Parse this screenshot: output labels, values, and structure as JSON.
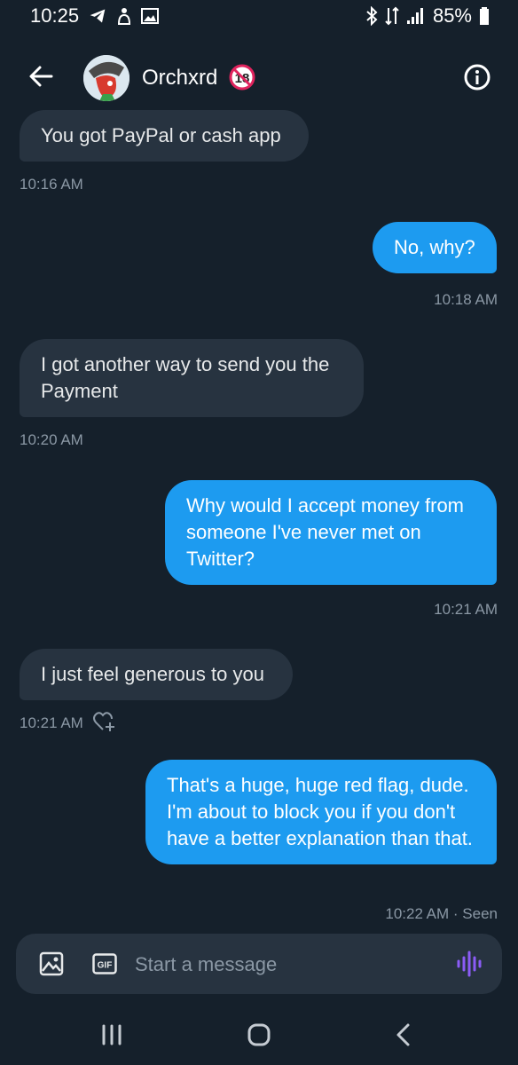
{
  "status_bar": {
    "time": "10:25",
    "battery": "85%",
    "icons": [
      "telegram-icon",
      "notification-icon",
      "gallery-icon",
      "bluetooth-icon",
      "data-icon",
      "signal-icon",
      "battery-icon"
    ]
  },
  "header": {
    "contact_name": "Orchxrd",
    "badge_text": "18"
  },
  "messages": [
    {
      "direction": "in",
      "text": "You got PayPal or cash app",
      "time": "10:16 AM"
    },
    {
      "direction": "out",
      "text": "No, why?",
      "time": "10:18 AM"
    },
    {
      "direction": "in",
      "text": "I got another way to send you the Payment",
      "time": "10:20 AM"
    },
    {
      "direction": "out",
      "text": "Why would I accept money from someone I've never met on Twitter?",
      "time": "10:21 AM"
    },
    {
      "direction": "in",
      "text": "I just feel generous to you",
      "time": "10:21 AM"
    },
    {
      "direction": "out",
      "text": "That's a huge, huge red flag, dude. I'm about to block you if you don't have a better explanation than that.",
      "time": "10:22 AM · Seen"
    }
  ],
  "composer": {
    "placeholder": "Start a message",
    "gif_label": "GIF"
  },
  "colors": {
    "background": "#15202b",
    "incoming_bubble": "#273340",
    "outgoing_bubble": "#1d9bf0",
    "timestamp": "#8b98a5",
    "voice_accent": "#8b5cf6",
    "badge_red": "#e0245e"
  }
}
